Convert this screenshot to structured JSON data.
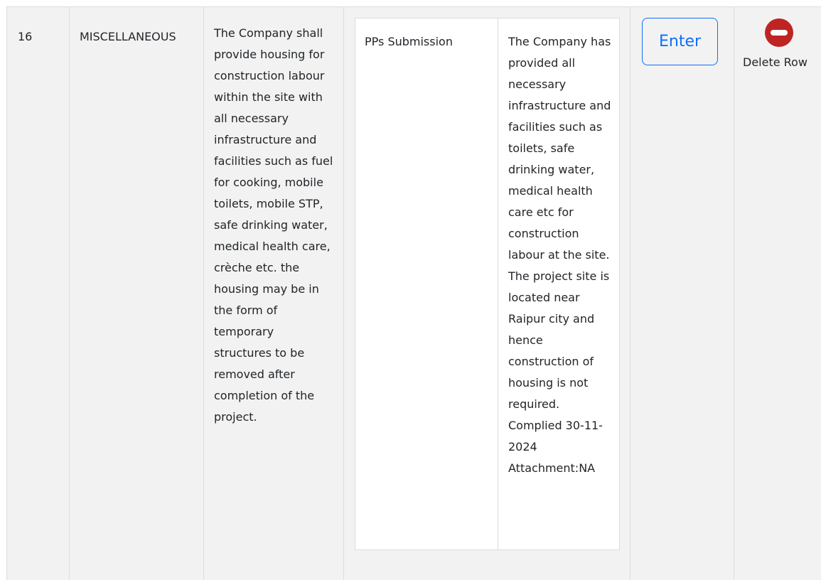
{
  "row": {
    "serial": "16",
    "category": "MISCELLANEOUS",
    "condition": "The Company shall provide housing for construction labour within the site with all necessary infrastructure and facilities such as fuel for cooking, mobile toilets, mobile STP, safe drinking water, medical health care, crèche etc. the housing may be in the form of temporary structures to be removed after completion of the project.",
    "submission": {
      "label": "PPs Submission",
      "text": "The Company has provided all necessary infrastructure and facilities such as toilets, safe drinking water, medical health care etc for construction labour at the site. The project site is located near Raipur city and hence construction of housing is not required. Complied 30-11-2024 Attachment:NA"
    },
    "enter_label": "Enter",
    "delete_label": "Delete Row",
    "delete_icon": "minus-circle-icon"
  },
  "colors": {
    "accent": "#0d6efd",
    "delete": "#bf2424",
    "cell_bg": "#f2f2f2"
  }
}
